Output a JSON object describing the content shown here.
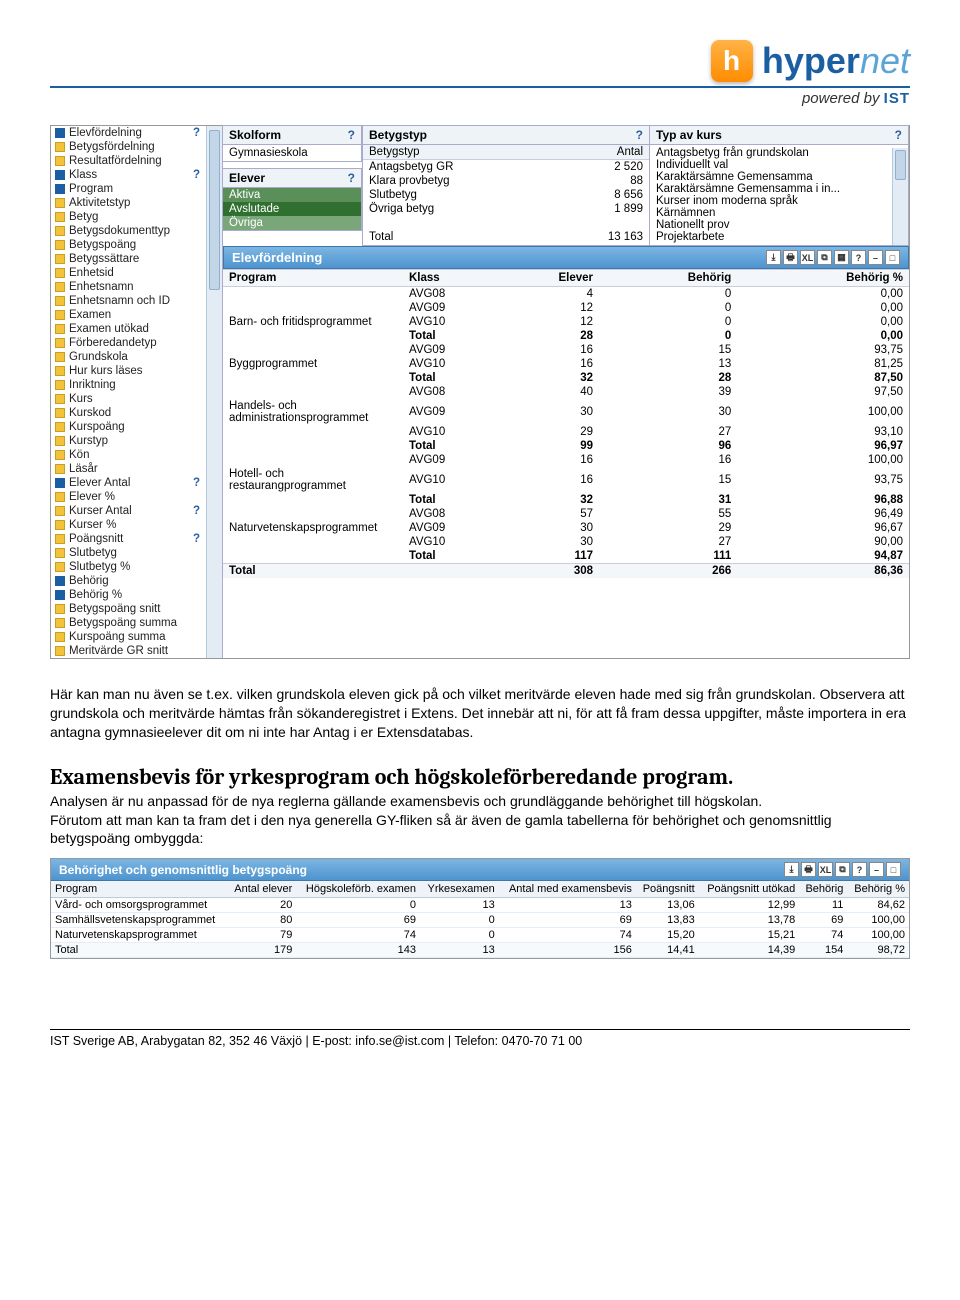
{
  "logo": {
    "brand_a": "hyper",
    "brand_b": "net",
    "powered_prefix": "powered by ",
    "powered_brand": "IST"
  },
  "sidebar": {
    "items": [
      {
        "label": "Elevfördelning",
        "filled": true,
        "help": true
      },
      {
        "label": "Betygsfördelning",
        "yellow": true
      },
      {
        "label": "Resultatfördelning",
        "yellow": true
      },
      {
        "label": "Klass",
        "filled": true,
        "help": true
      },
      {
        "label": "Program",
        "filled": true
      },
      {
        "label": "Aktivitetstyp",
        "yellow": true
      },
      {
        "label": "Betyg",
        "yellow": true
      },
      {
        "label": "Betygsdokumenttyp",
        "yellow": true
      },
      {
        "label": "Betygspoäng",
        "yellow": true
      },
      {
        "label": "Betygssättare",
        "yellow": true
      },
      {
        "label": "Enhetsid",
        "yellow": true
      },
      {
        "label": "Enhetsnamn",
        "yellow": true
      },
      {
        "label": "Enhetsnamn och ID",
        "yellow": true
      },
      {
        "label": "Examen",
        "yellow": true
      },
      {
        "label": "Examen utökad",
        "yellow": true
      },
      {
        "label": "Förberedandetyp",
        "yellow": true
      },
      {
        "label": "Grundskola",
        "yellow": true
      },
      {
        "label": "Hur kurs läses",
        "yellow": true
      },
      {
        "label": "Inriktning",
        "yellow": true
      },
      {
        "label": "Kurs",
        "yellow": true
      },
      {
        "label": "Kurskod",
        "yellow": true
      },
      {
        "label": "Kurspoäng",
        "yellow": true
      },
      {
        "label": "Kurstyp",
        "yellow": true
      },
      {
        "label": "Kön",
        "yellow": true
      },
      {
        "label": "Läsår",
        "yellow": true
      },
      {
        "label": "Elever Antal",
        "filled": true,
        "help": true
      },
      {
        "label": "Elever %",
        "yellow": true
      },
      {
        "label": "Kurser Antal",
        "yellow": true,
        "help": true
      },
      {
        "label": "Kurser %",
        "yellow": true
      },
      {
        "label": "Poängsnitt",
        "yellow": true,
        "help": true
      },
      {
        "label": "Slutbetyg",
        "yellow": true
      },
      {
        "label": "Slutbetyg %",
        "yellow": true
      },
      {
        "label": "Behörig",
        "filled": true
      },
      {
        "label": "Behörig %",
        "filled": true
      },
      {
        "label": "Betygspoäng snitt",
        "yellow": true
      },
      {
        "label": "Betygspoäng summa",
        "yellow": true
      },
      {
        "label": "Kurspoäng summa",
        "yellow": true
      },
      {
        "label": "Meritvärde GR snitt",
        "yellow": true
      }
    ]
  },
  "skolform": {
    "title": "Skolform",
    "value": "Gymnasieskola"
  },
  "elever_panel": {
    "title": "Elever",
    "options": [
      "Aktiva",
      "Avslutade",
      "Övriga"
    ]
  },
  "betygstyp": {
    "title": "Betygstyp",
    "col_a": "Betygstyp",
    "col_b": "Antal",
    "rows": [
      {
        "name": "Antagsbetyg GR",
        "n": "2 520"
      },
      {
        "name": "Klara provbetyg",
        "n": "88"
      },
      {
        "name": "Slutbetyg",
        "n": "8 656"
      },
      {
        "name": "Övriga betyg",
        "n": "1 899"
      }
    ],
    "total_label": "Total",
    "total_n": "13 163"
  },
  "typkurs": {
    "title": "Typ av kurs",
    "rows": [
      "Antagsbetyg från grundskolan",
      "Individuellt val",
      "Karaktärsämne Gemensamma",
      "Karaktärsämne Gemensamma i in...",
      "Kurser inom moderna språk",
      "Kärnämnen",
      "Nationellt prov",
      "Projektarbete"
    ]
  },
  "elevford": {
    "title": "Elevfördelning",
    "cols": [
      "Program",
      "Klass",
      "Elever",
      "Behörig",
      "Behörig %"
    ],
    "groups": [
      {
        "program": "",
        "rows": [
          [
            "",
            "AVG08",
            "4",
            "0",
            "0,00"
          ]
        ]
      },
      {
        "program": "Barn- och fritidsprogrammet",
        "rows": [
          [
            "",
            "AVG09",
            "12",
            "0",
            "0,00"
          ],
          [
            "",
            "AVG10",
            "12",
            "0",
            "0,00"
          ],
          [
            "",
            "Total",
            "28",
            "0",
            "0,00"
          ]
        ]
      },
      {
        "program": "Byggprogrammet",
        "rows": [
          [
            "",
            "AVG09",
            "16",
            "15",
            "93,75"
          ],
          [
            "",
            "AVG10",
            "16",
            "13",
            "81,25"
          ],
          [
            "",
            "Total",
            "32",
            "28",
            "87,50"
          ]
        ]
      },
      {
        "program": "Handels- och administrationsprogrammet",
        "rows": [
          [
            "",
            "AVG08",
            "40",
            "39",
            "97,50"
          ],
          [
            "",
            "AVG09",
            "30",
            "30",
            "100,00"
          ],
          [
            "",
            "AVG10",
            "29",
            "27",
            "93,10"
          ],
          [
            "",
            "Total",
            "99",
            "96",
            "96,97"
          ]
        ]
      },
      {
        "program": "Hotell- och restaurangprogrammet",
        "rows": [
          [
            "",
            "AVG09",
            "16",
            "16",
            "100,00"
          ],
          [
            "",
            "AVG10",
            "16",
            "15",
            "93,75"
          ],
          [
            "",
            "Total",
            "32",
            "31",
            "96,88"
          ]
        ]
      },
      {
        "program": "Naturvetenskapsprogrammet",
        "rows": [
          [
            "",
            "AVG08",
            "57",
            "55",
            "96,49"
          ],
          [
            "",
            "AVG09",
            "30",
            "29",
            "96,67"
          ],
          [
            "",
            "AVG10",
            "30",
            "27",
            "90,00"
          ],
          [
            "",
            "Total",
            "117",
            "111",
            "94,87"
          ]
        ]
      }
    ],
    "grand": [
      "Total",
      "",
      "308",
      "266",
      "86,36"
    ]
  },
  "body": {
    "p1": "Här kan man nu även se t.ex. vilken grundskola eleven gick på och vilket meritvärde eleven hade med sig från grundskolan. Observera att grundskola och meritvärde hämtas från sökanderegistret i Extens. Det innebär att ni, för att få fram dessa uppgifter, måste importera in era antagna gymnasieelever dit om ni inte har Antag i er Extensdatabas.",
    "h2": "Examensbevis för yrkesprogram och högskoleförberedande program.",
    "p2": "Analysen är nu anpassad för de nya reglerna gällande examensbevis och grundläggande behörighet till högskolan.",
    "p3": "Förutom att man kan ta fram det i den nya generella GY-fliken så är även de gamla tabellerna för behörighet och genomsnittlig betygspoäng ombyggda:"
  },
  "shot2": {
    "title": "Behörighet och genomsnittlig betygspoäng",
    "cols": [
      "Program",
      "Antal elever",
      "Högskoleförb. examen",
      "Yrkesexamen",
      "Antal med examensbevis",
      "Poängsnitt",
      "Poängsnitt utökad",
      "Behörig",
      "Behörig %"
    ],
    "rows": [
      [
        "Vård- och omsorgsprogrammet",
        "20",
        "0",
        "13",
        "13",
        "13,06",
        "12,99",
        "11",
        "84,62"
      ],
      [
        "Samhällsvetenskapsprogrammet",
        "80",
        "69",
        "0",
        "69",
        "13,83",
        "13,78",
        "69",
        "100,00"
      ],
      [
        "Naturvetenskapsprogrammet",
        "79",
        "74",
        "0",
        "74",
        "15,20",
        "15,21",
        "74",
        "100,00"
      ]
    ],
    "total": [
      "Total",
      "179",
      "143",
      "13",
      "156",
      "14,41",
      "14,39",
      "154",
      "98,72"
    ]
  },
  "footer": "IST Sverige AB, Arabygatan 82, 352 46 Växjö   |   E-post: info.se@ist.com   |   Telefon: 0470-70 71 00"
}
